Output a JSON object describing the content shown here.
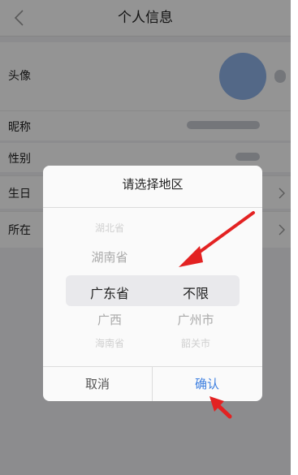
{
  "header": {
    "title": "个人信息"
  },
  "profile": {
    "rows": [
      {
        "label": "头像"
      },
      {
        "label": "昵称"
      },
      {
        "label": "性别"
      },
      {
        "label": "生日"
      },
      {
        "label": "所在"
      }
    ]
  },
  "dialog": {
    "title": "请选择地区",
    "provinces": [
      "湖北省",
      "湖南省",
      "广东省",
      "广西",
      "海南省"
    ],
    "cities": [
      "不限",
      "广州市",
      "韶关市"
    ],
    "selected_province": "广东省",
    "selected_city": "不限",
    "cancel_label": "取消",
    "confirm_label": "确认"
  },
  "colors": {
    "confirm": "#3d7fe0",
    "annotation_arrow": "#e32222"
  }
}
